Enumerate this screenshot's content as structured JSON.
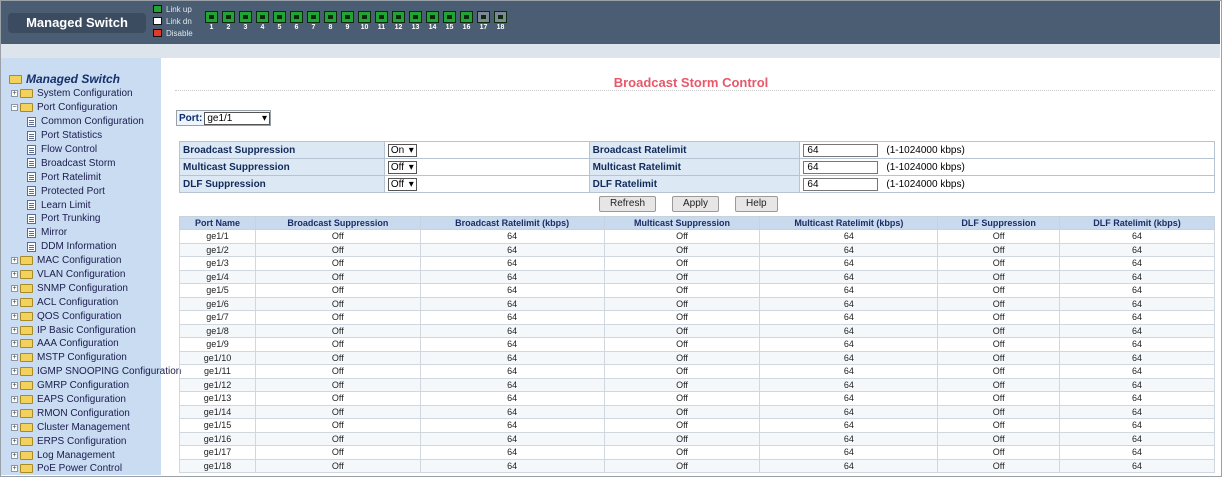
{
  "header": {
    "brand": "Managed Switch",
    "legend": [
      {
        "label": "Link up",
        "color": "#22a335"
      },
      {
        "label": "Link dn",
        "color": "#ffffff"
      },
      {
        "label": "Disable",
        "color": "#e23a2a"
      }
    ],
    "ports": [
      "1",
      "2",
      "3",
      "4",
      "5",
      "6",
      "7",
      "8",
      "9",
      "10",
      "11",
      "12",
      "13",
      "14",
      "15",
      "16",
      "17",
      "18"
    ]
  },
  "sidebar": {
    "root": "Managed Switch",
    "items": [
      {
        "label": "System Configuration",
        "type": "folder",
        "expanded": false
      },
      {
        "label": "Port Configuration",
        "type": "folder",
        "expanded": true
      },
      {
        "label": "Common Configuration",
        "type": "page"
      },
      {
        "label": "Port Statistics",
        "type": "page"
      },
      {
        "label": "Flow Control",
        "type": "page"
      },
      {
        "label": "Broadcast Storm",
        "type": "page"
      },
      {
        "label": "Port Ratelimit",
        "type": "page"
      },
      {
        "label": "Protected Port",
        "type": "page"
      },
      {
        "label": "Learn Limit",
        "type": "page"
      },
      {
        "label": "Port Trunking",
        "type": "page"
      },
      {
        "label": "Mirror",
        "type": "page"
      },
      {
        "label": "DDM Information",
        "type": "page"
      },
      {
        "label": "MAC Configuration",
        "type": "folder",
        "expanded": false
      },
      {
        "label": "VLAN Configuration",
        "type": "folder",
        "expanded": false
      },
      {
        "label": "SNMP Configuration",
        "type": "folder",
        "expanded": false
      },
      {
        "label": "ACL Configuration",
        "type": "folder",
        "expanded": false
      },
      {
        "label": "QOS Configuration",
        "type": "folder",
        "expanded": false
      },
      {
        "label": "IP Basic Configuration",
        "type": "folder",
        "expanded": false
      },
      {
        "label": "AAA Configuration",
        "type": "folder",
        "expanded": false
      },
      {
        "label": "MSTP Configuration",
        "type": "folder",
        "expanded": false
      },
      {
        "label": "IGMP SNOOPING Configuration",
        "type": "folder",
        "expanded": false
      },
      {
        "label": "GMRP Configuration",
        "type": "folder",
        "expanded": false
      },
      {
        "label": "EAPS Configuration",
        "type": "folder",
        "expanded": false
      },
      {
        "label": "RMON Configuration",
        "type": "folder",
        "expanded": false
      },
      {
        "label": "Cluster Management",
        "type": "folder",
        "expanded": false
      },
      {
        "label": "ERPS Configuration",
        "type": "folder",
        "expanded": false
      },
      {
        "label": "Log Management",
        "type": "folder",
        "expanded": false
      },
      {
        "label": "PoE Power Control",
        "type": "folder",
        "expanded": false
      }
    ]
  },
  "main": {
    "title": "Broadcast Storm Control",
    "port_label": "Port:",
    "port_value": "ge1/1",
    "config": [
      {
        "label": "Broadcast Suppression",
        "value": "On",
        "rate_label": "Broadcast Ratelimit",
        "rate_value": "64",
        "hint": "(1-1024000 kbps)"
      },
      {
        "label": "Multicast Suppression",
        "value": "Off",
        "rate_label": "Multicast Ratelimit",
        "rate_value": "64",
        "hint": "(1-1024000 kbps)"
      },
      {
        "label": "DLF Suppression",
        "value": "Off",
        "rate_label": "DLF Ratelimit",
        "rate_value": "64",
        "hint": "(1-1024000 kbps)"
      }
    ],
    "buttons": {
      "refresh": "Refresh",
      "apply": "Apply",
      "help": "Help"
    },
    "table": {
      "headers": [
        "Port Name",
        "Broadcast Suppression",
        "Broadcast Ratelimit (kbps)",
        "Multicast Suppression",
        "Multicast Ratelimit (kbps)",
        "DLF Suppression",
        "DLF Ratelimit (kbps)"
      ],
      "rows": [
        [
          "ge1/1",
          "Off",
          "64",
          "Off",
          "64",
          "Off",
          "64"
        ],
        [
          "ge1/2",
          "Off",
          "64",
          "Off",
          "64",
          "Off",
          "64"
        ],
        [
          "ge1/3",
          "Off",
          "64",
          "Off",
          "64",
          "Off",
          "64"
        ],
        [
          "ge1/4",
          "Off",
          "64",
          "Off",
          "64",
          "Off",
          "64"
        ],
        [
          "ge1/5",
          "Off",
          "64",
          "Off",
          "64",
          "Off",
          "64"
        ],
        [
          "ge1/6",
          "Off",
          "64",
          "Off",
          "64",
          "Off",
          "64"
        ],
        [
          "ge1/7",
          "Off",
          "64",
          "Off",
          "64",
          "Off",
          "64"
        ],
        [
          "ge1/8",
          "Off",
          "64",
          "Off",
          "64",
          "Off",
          "64"
        ],
        [
          "ge1/9",
          "Off",
          "64",
          "Off",
          "64",
          "Off",
          "64"
        ],
        [
          "ge1/10",
          "Off",
          "64",
          "Off",
          "64",
          "Off",
          "64"
        ],
        [
          "ge1/11",
          "Off",
          "64",
          "Off",
          "64",
          "Off",
          "64"
        ],
        [
          "ge1/12",
          "Off",
          "64",
          "Off",
          "64",
          "Off",
          "64"
        ],
        [
          "ge1/13",
          "Off",
          "64",
          "Off",
          "64",
          "Off",
          "64"
        ],
        [
          "ge1/14",
          "Off",
          "64",
          "Off",
          "64",
          "Off",
          "64"
        ],
        [
          "ge1/15",
          "Off",
          "64",
          "Off",
          "64",
          "Off",
          "64"
        ],
        [
          "ge1/16",
          "Off",
          "64",
          "Off",
          "64",
          "Off",
          "64"
        ],
        [
          "ge1/17",
          "Off",
          "64",
          "Off",
          "64",
          "Off",
          "64"
        ],
        [
          "ge1/18",
          "Off",
          "64",
          "Off",
          "64",
          "Off",
          "64"
        ]
      ]
    }
  }
}
